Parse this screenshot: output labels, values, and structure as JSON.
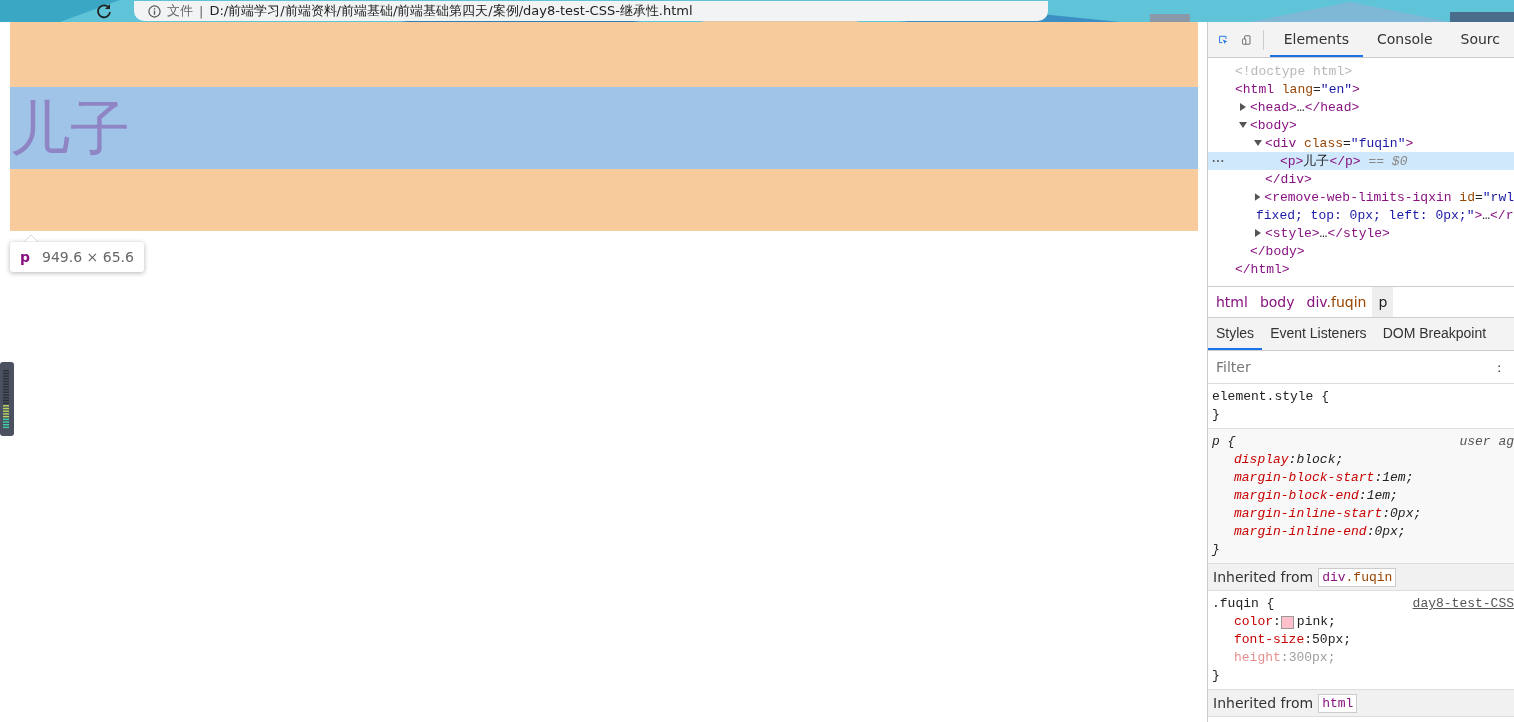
{
  "browser": {
    "address_prefix": "文件",
    "address_separator": "|",
    "address": "D:/前端学习/前端资料/前端基础/前端基础第四天/案例/day8-test-CSS-继承性.html"
  },
  "page": {
    "element_text": "儿子",
    "tooltip": {
      "tag": "p",
      "size": "949.6 × 65.6"
    }
  },
  "devtools": {
    "tabs": [
      {
        "label": "Elements",
        "selected": true
      },
      {
        "label": "Console",
        "selected": false
      },
      {
        "label": "Sourc",
        "selected": false
      }
    ],
    "dom_tree": [
      {
        "lines": [
          [
            {
              "t": "<!doctype html>",
              "kind": "doctype"
            }
          ]
        ]
      },
      {
        "lines": [
          [
            {
              "t": "<html",
              "kind": "tag"
            },
            {
              "t": " lang",
              "kind": "attr"
            },
            {
              "t": "=",
              "kind": "text"
            },
            {
              "t": "\"en\"",
              "kind": "val"
            },
            {
              "t": ">",
              "kind": "tag"
            }
          ]
        ],
        "children": [
          {
            "expanded": false,
            "lines": [
              [
                {
                  "t": "<head>",
                  "kind": "tag"
                },
                {
                  "t": "…",
                  "kind": "text"
                },
                {
                  "t": "</head>",
                  "kind": "tag"
                }
              ]
            ]
          },
          {
            "expanded": true,
            "lines": [
              [
                {
                  "t": "<body>",
                  "kind": "tag"
                }
              ]
            ],
            "children": [
              {
                "expanded": true,
                "lines": [
                  [
                    {
                      "t": "<div",
                      "kind": "tag"
                    },
                    {
                      "t": " class",
                      "kind": "attr"
                    },
                    {
                      "t": "=",
                      "kind": "text"
                    },
                    {
                      "t": "\"fuqin\"",
                      "kind": "val"
                    },
                    {
                      "t": ">",
                      "kind": "tag"
                    }
                  ]
                ],
                "children": [
                  {
                    "selected": true,
                    "lines": [
                      [
                        {
                          "t": "<p>",
                          "kind": "tag"
                        },
                        {
                          "t": "儿子",
                          "kind": "text"
                        },
                        {
                          "t": "</p>",
                          "kind": "tag"
                        },
                        {
                          "t": " == $0",
                          "kind": "hint"
                        }
                      ]
                    ]
                  }
                ],
                "close": [
                  {
                    "t": "</div>",
                    "kind": "tag"
                  }
                ]
              },
              {
                "expanded": false,
                "lines": [
                  [
                    {
                      "t": "<remove-web-limits-iqxin",
                      "kind": "tag"
                    },
                    {
                      "t": " id",
                      "kind": "attr"
                    },
                    {
                      "t": "=",
                      "kind": "text"
                    },
                    {
                      "t": "\"rwl",
                      "kind": "val"
                    }
                  ],
                  [
                    {
                      "t": "fixed; top: 0px; left: 0px;\"",
                      "kind": "val"
                    },
                    {
                      "t": ">",
                      "kind": "tag"
                    },
                    {
                      "t": "…",
                      "kind": "text"
                    },
                    {
                      "t": "</r",
                      "kind": "tag"
                    }
                  ]
                ]
              },
              {
                "expanded": false,
                "lines": [
                  [
                    {
                      "t": "<style>",
                      "kind": "tag"
                    },
                    {
                      "t": "…",
                      "kind": "text"
                    },
                    {
                      "t": "</style>",
                      "kind": "tag"
                    }
                  ]
                ]
              }
            ],
            "close": [
              {
                "t": "</body>",
                "kind": "tag"
              }
            ]
          }
        ],
        "close": [
          {
            "t": "</html>",
            "kind": "tag"
          }
        ]
      }
    ],
    "breadcrumbs": [
      {
        "parts": [
          {
            "t": "html",
            "kind": "tag"
          }
        ],
        "selected": false
      },
      {
        "parts": [
          {
            "t": "body",
            "kind": "tag"
          }
        ],
        "selected": false
      },
      {
        "parts": [
          {
            "t": "div",
            "kind": "tag"
          },
          {
            "t": ".fuqin",
            "kind": "attr"
          }
        ],
        "selected": false
      },
      {
        "parts": [
          {
            "t": "p",
            "kind": "text"
          }
        ],
        "selected": true
      }
    ],
    "style_tabs": [
      {
        "label": "Styles",
        "selected": true
      },
      {
        "label": "Event Listeners",
        "selected": false
      },
      {
        "label": "DOM Breakpoint",
        "selected": false
      }
    ],
    "filter": {
      "placeholder": "Filter"
    },
    "filter_toggle": ":",
    "styles": [
      {
        "kind": "rule",
        "selector": "element.style {",
        "user_agent": false,
        "close": "}"
      },
      {
        "kind": "rule",
        "selector": "p {",
        "user_agent": true,
        "source": "user ag",
        "link": false,
        "decls": [
          {
            "prop": "display",
            "sep": ":",
            "value": "block;",
            "inactive": false
          },
          {
            "prop": "margin-block-start",
            "sep": ":",
            "value": "1em;",
            "inactive": false
          },
          {
            "prop": "margin-block-end",
            "sep": ":",
            "value": "1em;",
            "inactive": false
          },
          {
            "prop": "margin-inline-start",
            "sep": ":",
            "value": "0px;",
            "inactive": false
          },
          {
            "prop": "margin-inline-end",
            "sep": ":",
            "value": "0px;",
            "inactive": false
          }
        ],
        "close": "}"
      },
      {
        "kind": "inherited",
        "label": "Inherited from",
        "from": [
          {
            "t": "div",
            "kind": "tag"
          },
          {
            "t": ".fuqin",
            "kind": "attr"
          }
        ]
      },
      {
        "kind": "rule",
        "selector": ".fuqin {",
        "user_agent": false,
        "source": "day8-test-CSS",
        "link": true,
        "decls": [
          {
            "prop": "color",
            "sep": ":",
            "value": "pink;",
            "color": "#ffc0cb",
            "inactive": false
          },
          {
            "prop": "font-size",
            "sep": ":",
            "value": "50px;",
            "inactive": false
          },
          {
            "prop": "height",
            "sep": ":",
            "value": "300px;",
            "inactive": true
          }
        ],
        "close": "}"
      },
      {
        "kind": "inherited",
        "label": "Inherited from",
        "from": [
          {
            "t": "html",
            "kind": "tag"
          }
        ]
      }
    ]
  }
}
